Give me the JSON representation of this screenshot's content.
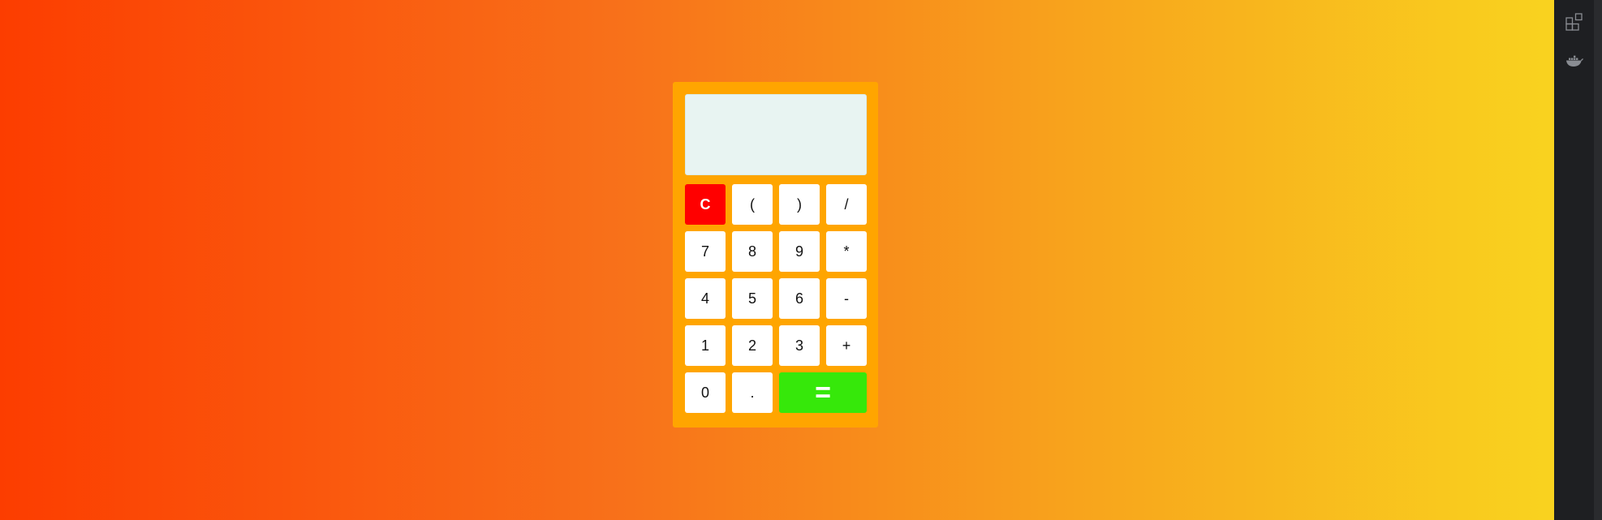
{
  "calculator": {
    "display_value": "",
    "keys": {
      "clear": "C",
      "open_paren": "(",
      "close_paren": ")",
      "divide": "/",
      "seven": "7",
      "eight": "8",
      "nine": "9",
      "multiply": "*",
      "four": "4",
      "five": "5",
      "six": "6",
      "minus": "-",
      "one": "1",
      "two": "2",
      "three": "3",
      "plus": "+",
      "zero": "0",
      "decimal": ".",
      "equals": "="
    },
    "colors": {
      "body": "#ffa500",
      "display": "#e8f4f2",
      "clear": "#ff0000",
      "equals": "#36e80a",
      "key": "#ffffff"
    }
  },
  "background": {
    "gradient": [
      "#fc3d00",
      "#f8711a",
      "#f8a51c",
      "#f9d31f"
    ]
  },
  "side_panel": {
    "icons": [
      "extensions-icon",
      "docker-icon"
    ]
  }
}
